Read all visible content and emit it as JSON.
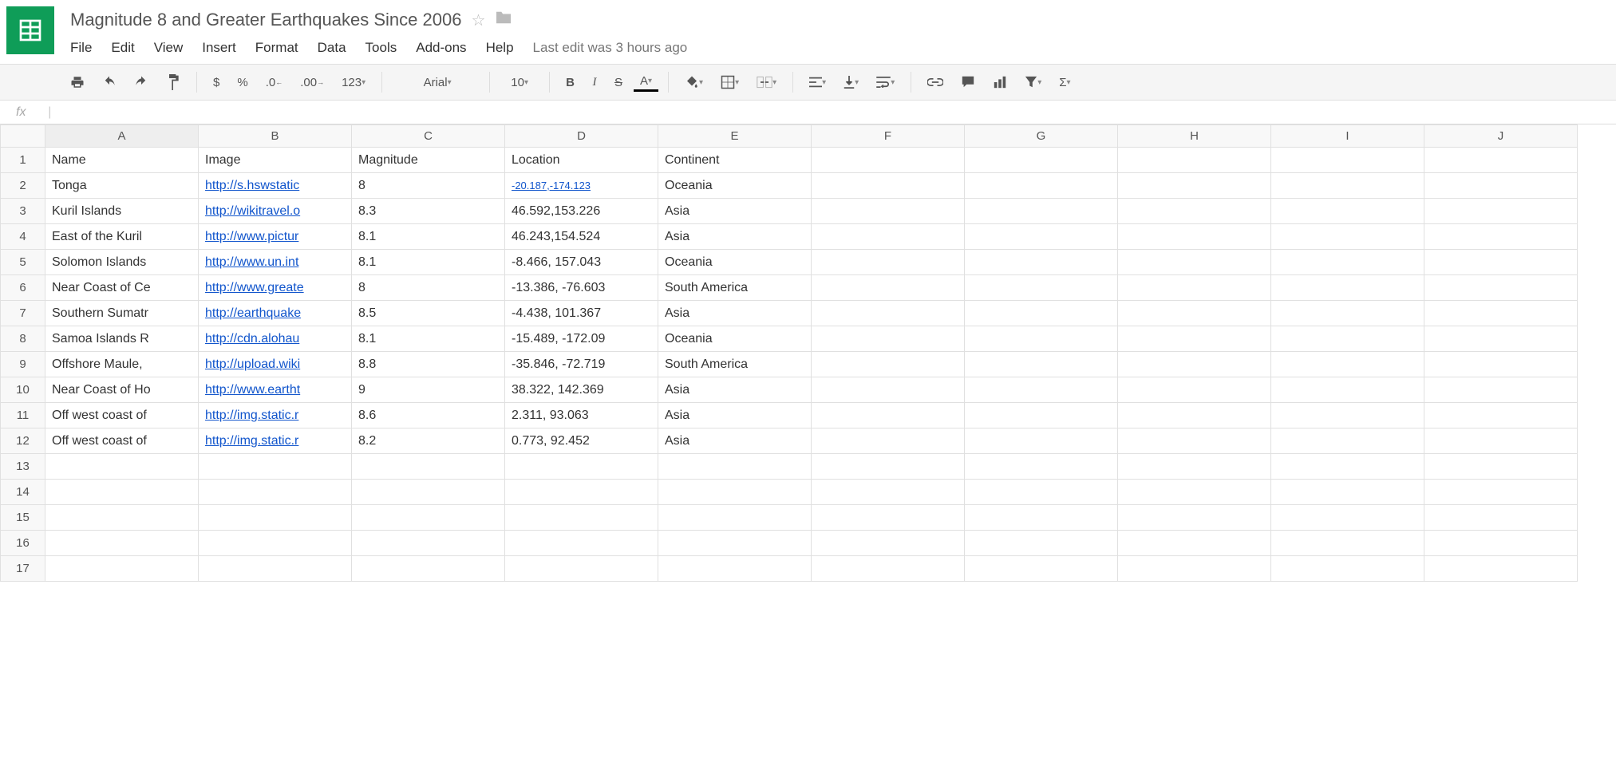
{
  "title": "Magnitude 8 and Greater Earthquakes Since 2006",
  "menus": [
    "File",
    "Edit",
    "View",
    "Insert",
    "Format",
    "Data",
    "Tools",
    "Add-ons",
    "Help"
  ],
  "lastedit": "Last edit was 3 hours ago",
  "toolbar": {
    "currency": "$",
    "percent": "%",
    "decdec": ".0",
    "incdec": ".00",
    "numfmt": "123",
    "fontname": "Arial",
    "fontsize": "10",
    "bold": "B",
    "italic": "I",
    "strike": "S",
    "textA": "A",
    "sigma": "Σ"
  },
  "fx": "fx",
  "columns": [
    "A",
    "B",
    "C",
    "D",
    "E",
    "F",
    "G",
    "H",
    "I",
    "J"
  ],
  "rowcount": 17,
  "headersRow": {
    "A": "Name",
    "B": "Image",
    "C": "Magnitude",
    "D": "Location",
    "E": "Continent"
  },
  "rows": [
    {
      "A": "Tonga",
      "B": "http://s.hswstatic",
      "C": "8",
      "D": "-20.187,-174.123",
      "Dlink": true,
      "E": "Oceania"
    },
    {
      "A": "Kuril Islands",
      "B": "http://wikitravel.o",
      "C": "8.3",
      "D": "46.592,153.226",
      "E": "Asia"
    },
    {
      "A": "East of the Kuril",
      "B": "http://www.pictur",
      "C": "8.1",
      "D": "46.243,154.524",
      "E": "Asia"
    },
    {
      "A": "Solomon Islands",
      "B": "http://www.un.int",
      "C": "8.1",
      "D": "-8.466, 157.043",
      "E": "Oceania"
    },
    {
      "A": "Near Coast of Ce",
      "B": "http://www.greate",
      "C": "8",
      "D": "-13.386, -76.603",
      "E": "South America"
    },
    {
      "A": "Southern Sumatr",
      "B": "http://earthquake",
      "C": "8.5",
      "D": "-4.438, 101.367",
      "E": "Asia"
    },
    {
      "A": "Samoa Islands R",
      "B": "http://cdn.alohau",
      "C": "8.1",
      "D": "-15.489, -172.09",
      "E": "Oceania"
    },
    {
      "A": "Offshore Maule,",
      "B": "http://upload.wiki",
      "C": "8.8",
      "D": "-35.846, -72.719",
      "E": "South America"
    },
    {
      "A": "Near Coast of Ho",
      "B": "http://www.eartht",
      "C": "9",
      "D": "38.322, 142.369",
      "E": "Asia"
    },
    {
      "A": "Off west coast of",
      "B": "http://img.static.r",
      "C": "8.6",
      "D": "2.311, 93.063",
      "E": "Asia"
    },
    {
      "A": "Off west coast of",
      "B": "http://img.static.r",
      "C": "8.2",
      "D": "0.773, 92.452",
      "E": "Asia"
    }
  ]
}
